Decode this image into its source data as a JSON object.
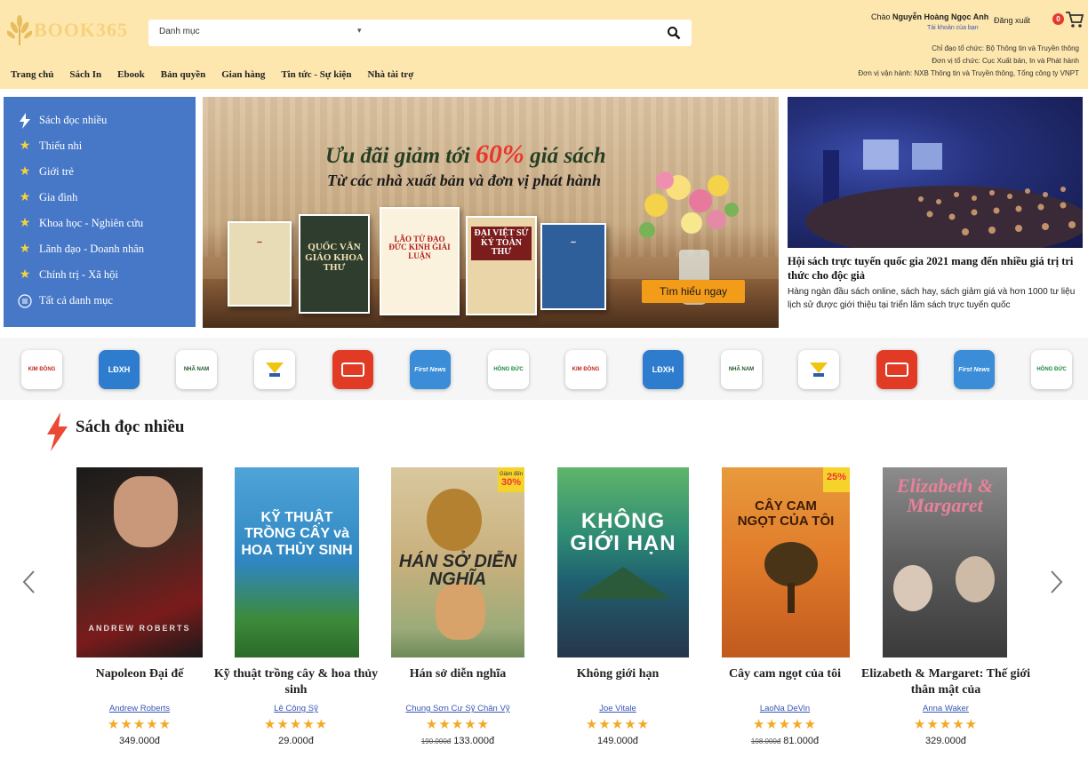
{
  "header": {
    "logo_text": "BOOK365",
    "search_category": "Danh mục",
    "greeting": "Chào",
    "user_name": "Nguyễn Hoàng Ngọc Anh",
    "account_link": "Tài khoản của bạn",
    "logout": "Đăng xuất",
    "cart_count": "0",
    "org_lines": [
      "Chỉ đạo tổ chức: Bộ Thông tin và Truyền thông",
      "Đơn vị tổ chức: Cục Xuất bản, In và Phát hành",
      "Đơn vị vận hành: NXB Thông tin và Truyền thông, Tổng công ty VNPT"
    ],
    "nav": [
      "Trang chủ",
      "Sách In",
      "Ebook",
      "Bản quyền",
      "Gian hàng",
      "Tin tức - Sự kiện",
      "Nhà tài trợ"
    ]
  },
  "sidebar": {
    "items": [
      {
        "label": "Sách đọc nhiều",
        "icon": "lightning-icon"
      },
      {
        "label": "Thiếu nhi",
        "icon": "star-icon"
      },
      {
        "label": "Giới trẻ",
        "icon": "star-icon"
      },
      {
        "label": "Gia đình",
        "icon": "star-icon"
      },
      {
        "label": "Khoa học - Nghiên cứu",
        "icon": "star-icon"
      },
      {
        "label": "Lãnh đạo - Doanh nhân",
        "icon": "star-icon"
      },
      {
        "label": "Chính trị - Xã hội",
        "icon": "star-icon"
      },
      {
        "label": "Tất cả danh mục",
        "icon": "list-icon"
      }
    ]
  },
  "banner": {
    "title_pre": "Ưu đãi giảm tới ",
    "title_hl": "60%",
    "title_post": " giá sách",
    "subtitle": "Từ các nhà xuất bản và đơn vị phát hành",
    "cta": "Tìm hiểu ngay",
    "books": [
      "QUỐC VĂN GIÁO KHOA THƯ",
      "LÃO TỬ ĐẠO ĐỨC KINH GIẢI LUẬN",
      "ĐẠI VIỆT SỬ KÝ TOÀN THƯ"
    ]
  },
  "news": {
    "title": "Hội sách trực tuyến quốc gia 2021 mang đến nhiều giá trị tri thức cho độc giả",
    "description": "Hàng ngàn đầu sách online, sách hay, sách giảm giá và hơn 1000 tư liệu lịch sử được giới thiệu tại triển lãm sách trực tuyến quốc"
  },
  "publishers": [
    "KIM ĐỒNG",
    "LĐXH",
    "NHÃ NAM",
    "",
    "",
    "First News",
    "HỒNG ĐỨC",
    "KIM ĐỒNG",
    "LĐXH",
    "NHÃ NAM",
    "",
    "",
    "First News",
    "HỒNG ĐỨC"
  ],
  "section": {
    "title": "Sách đọc nhiều"
  },
  "books": [
    {
      "title": "Napoleon Đại đế",
      "author": "Andrew Roberts",
      "price": "349.000đ",
      "old_price": "",
      "discount": "",
      "stars": "★★★★★",
      "cover_text": "ANDREW ROBERTS"
    },
    {
      "title": "Kỹ thuật trồng cây & hoa thủy sinh",
      "author": "Lê Công Sỹ",
      "price": "29.000đ",
      "old_price": "",
      "discount": "",
      "stars": "★★★★★",
      "cover_text": "KỸ THUẬT TRỒNG CÂY và HOA THỦY SINH"
    },
    {
      "title": "Hán sở diễn nghĩa",
      "author": "Chung Sơn Cư Sỹ Chân Vỹ",
      "price": "133.000đ",
      "old_price": "190.000đ",
      "discount": "30%",
      "stars": "★★★★★",
      "cover_text": "HÁN SỞ DIỄN NGHĨA"
    },
    {
      "title": "Không giới hạn",
      "author": "Joe Vitale",
      "price": "149.000đ",
      "old_price": "",
      "discount": "",
      "stars": "★★★★★",
      "cover_text": "KHÔNG GIỚI HẠN"
    },
    {
      "title": "Cây cam ngọt của tôi",
      "author": "LaoNa DeVin",
      "price": "81.000đ",
      "old_price": "108.000đ",
      "discount": "25%",
      "stars": "★★★★★",
      "cover_text": "CÂY CAM NGỌT CỦA TÔI"
    },
    {
      "title": "Elizabeth & Margaret: Thế giới thân mật của",
      "author": "Anna Waker",
      "price": "329.000đ",
      "old_price": "",
      "discount": "",
      "stars": "★★★★★",
      "cover_text": "Elizabeth & Margaret"
    }
  ],
  "colors": {
    "header_bg": "#fde7ae",
    "sidebar_bg": "#4778c7",
    "accent": "#f39c19",
    "star": "#f4a925",
    "link": "#3856b3"
  }
}
